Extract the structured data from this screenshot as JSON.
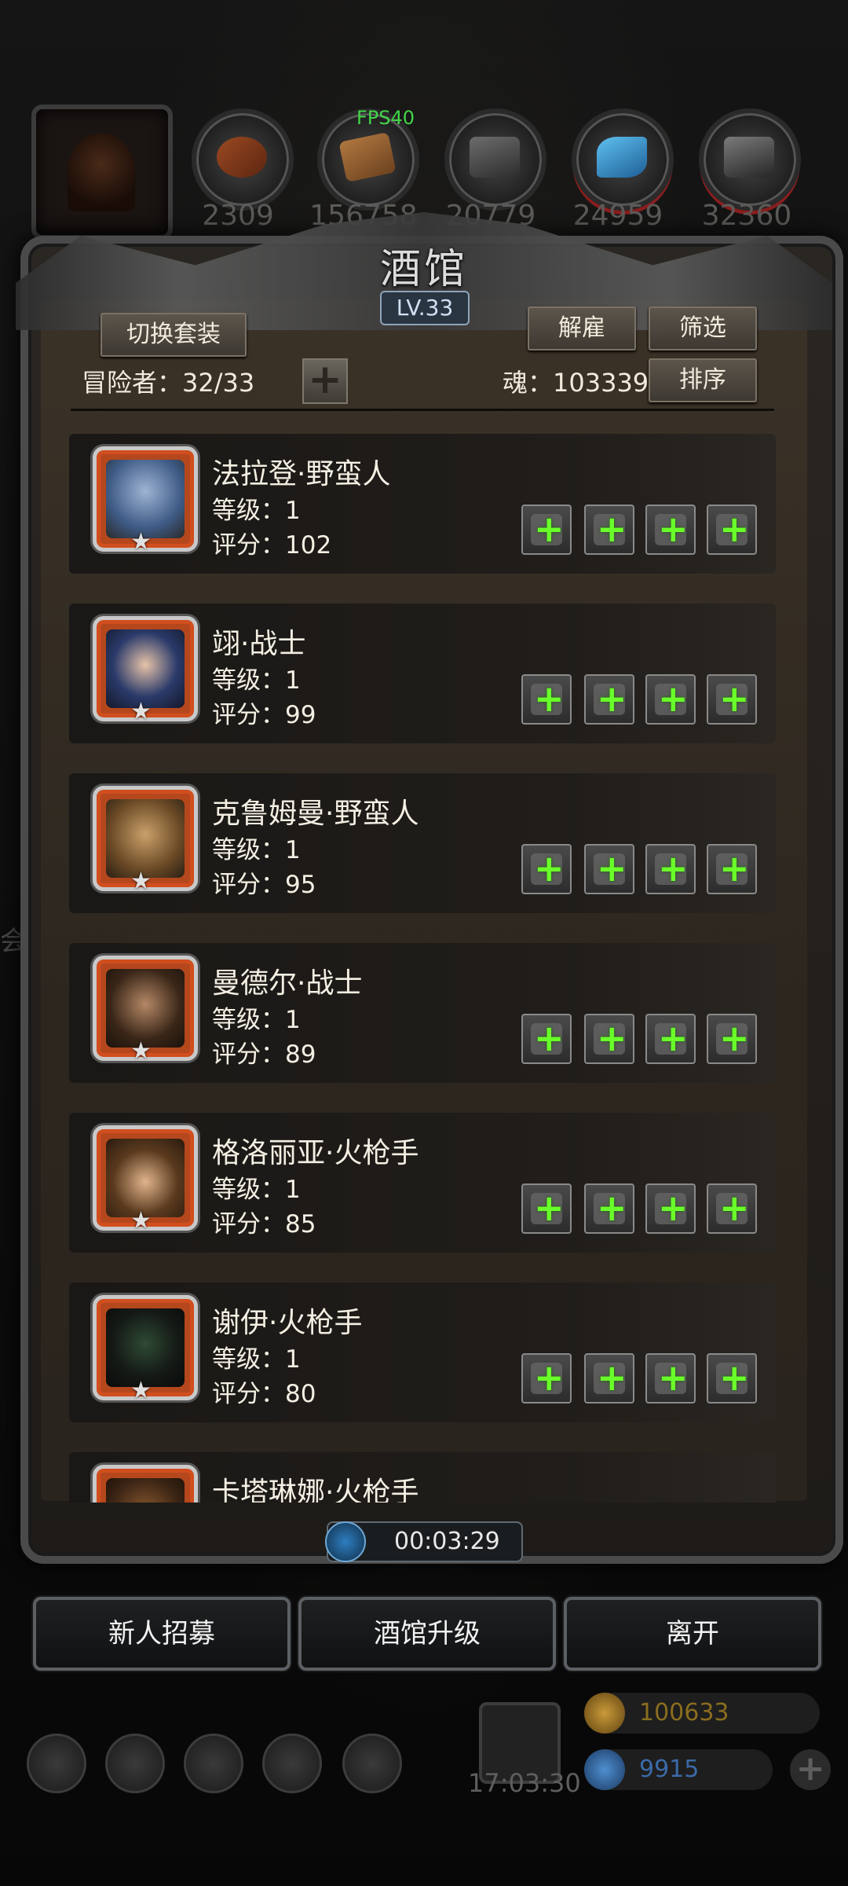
{
  "top_bar": {
    "fps": "FPS40",
    "resources": [
      {
        "icon": "leather-icon",
        "value": "2309"
      },
      {
        "icon": "wood-plank-icon",
        "value": "156758"
      },
      {
        "icon": "iron-ingot-icon",
        "value": "20779"
      },
      {
        "icon": "crystal-icon",
        "value": "24959"
      },
      {
        "icon": "metal-bar-icon",
        "value": "32360"
      }
    ]
  },
  "panel": {
    "title": "酒馆",
    "level": "LV.33",
    "switch_outfit": "切换套装",
    "dismiss": "解雇",
    "filter": "筛选",
    "sort": "排序",
    "adventurers_label": "冒险者：32/33",
    "soul_label": "魂：103339"
  },
  "heroes": [
    {
      "name": "法拉登·野蛮人",
      "level": "等级：1",
      "score": "评分：102"
    },
    {
      "name": "翊·战士",
      "level": "等级：1",
      "score": "评分：99"
    },
    {
      "name": "克鲁姆曼·野蛮人",
      "level": "等级：1",
      "score": "评分：95"
    },
    {
      "name": "曼德尔·战士",
      "level": "等级：1",
      "score": "评分：89"
    },
    {
      "name": "格洛丽亚·火枪手",
      "level": "等级：1",
      "score": "评分：85"
    },
    {
      "name": "谢伊·火枪手",
      "level": "等级：1",
      "score": "评分：80"
    },
    {
      "name": "卡塔琳娜·火枪手",
      "level": "",
      "score": ""
    }
  ],
  "timer": "00:03:29",
  "actions": {
    "recruit": "新人招募",
    "upgrade": "酒馆升级",
    "leave": "离开"
  },
  "bottom": {
    "clock": "17:03:30",
    "gold": "100633",
    "gems": "9915"
  },
  "colors": {
    "accent_green": "#6aff2a",
    "gold_text": "#8a6d1e",
    "gem_text": "#3b6aa8"
  }
}
